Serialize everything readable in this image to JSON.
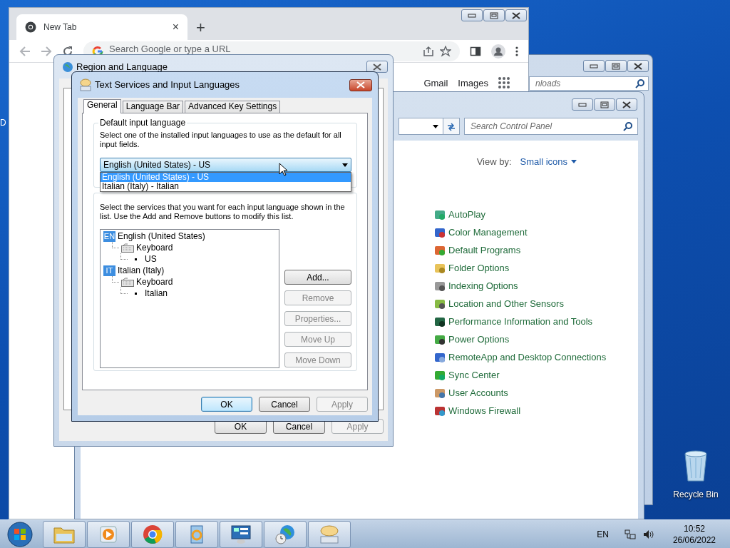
{
  "desktop": {
    "edge_label": "D",
    "icons": [
      {
        "label": "Recycle Bin"
      }
    ]
  },
  "browser": {
    "tab": {
      "title": "New Tab",
      "close": "×"
    },
    "new_tab": "+",
    "omnibox": {
      "placeholder": "Search Google or type a URL"
    },
    "links": [
      "Gmail",
      "Images"
    ]
  },
  "downloads_window": {
    "search": {
      "placeholder": "nloads"
    }
  },
  "control_panel": {
    "search": {
      "placeholder": "Search Control Panel"
    },
    "view_by": {
      "label": "View by:",
      "value": "Small icons"
    },
    "items": [
      "AutoPlay",
      "Color Management",
      "Default Programs",
      "Folder Options",
      "Indexing Options",
      "Location and Other Sensors",
      "Performance Information and Tools",
      "Power Options",
      "RemoteApp and Desktop Connections",
      "Sync Center",
      "User Accounts",
      "Windows Firewall"
    ]
  },
  "region_dialog": {
    "title": "Region and Language",
    "buttons": [
      {
        "label": "OK",
        "default": false,
        "disabled": false
      },
      {
        "label": "Cancel",
        "default": false,
        "disabled": false
      },
      {
        "label": "Apply",
        "default": false,
        "disabled": true
      }
    ]
  },
  "text_services": {
    "title": "Text Services and Input Languages",
    "tabs": [
      {
        "label": "General",
        "selected": true
      },
      {
        "label": "Language Bar",
        "selected": false
      },
      {
        "label": "Advanced Key Settings",
        "selected": false
      }
    ],
    "default_language": {
      "legend": "Default input language",
      "description": "Select one of the installed input languages to use as the default for all input fields.",
      "value": "English (United States) - US",
      "expanded": true,
      "options": [
        {
          "label": "English (United States) - US",
          "selected": true
        },
        {
          "label": "Italian (Italy) - Italian",
          "selected": false
        }
      ]
    },
    "installed_services": {
      "description": "Select the services that you want for each input language shown in the list. Use the Add and Remove buttons to modify this list.",
      "tree": [
        {
          "badge": "EN",
          "label": "English (United States)",
          "children": [
            {
              "label": "Keyboard",
              "children": [
                {
                  "label": "US"
                }
              ]
            }
          ]
        },
        {
          "badge": "IT",
          "label": "Italian (Italy)",
          "children": [
            {
              "label": "Keyboard",
              "children": [
                {
                  "label": "Italian"
                }
              ]
            }
          ]
        }
      ],
      "side_buttons": [
        {
          "label": "Add...",
          "disabled": false
        },
        {
          "label": "Remove",
          "disabled": true
        },
        {
          "label": "Properties...",
          "disabled": true
        },
        {
          "label": "Move Up",
          "disabled": true
        },
        {
          "label": "Move Down",
          "disabled": true
        }
      ]
    },
    "buttons": [
      {
        "label": "OK",
        "default": true,
        "disabled": false
      },
      {
        "label": "Cancel",
        "default": false,
        "disabled": false
      },
      {
        "label": "Apply",
        "default": false,
        "disabled": true
      }
    ]
  },
  "taskbar": {
    "language": "EN",
    "time": "10:52",
    "date": "26/06/2022"
  }
}
